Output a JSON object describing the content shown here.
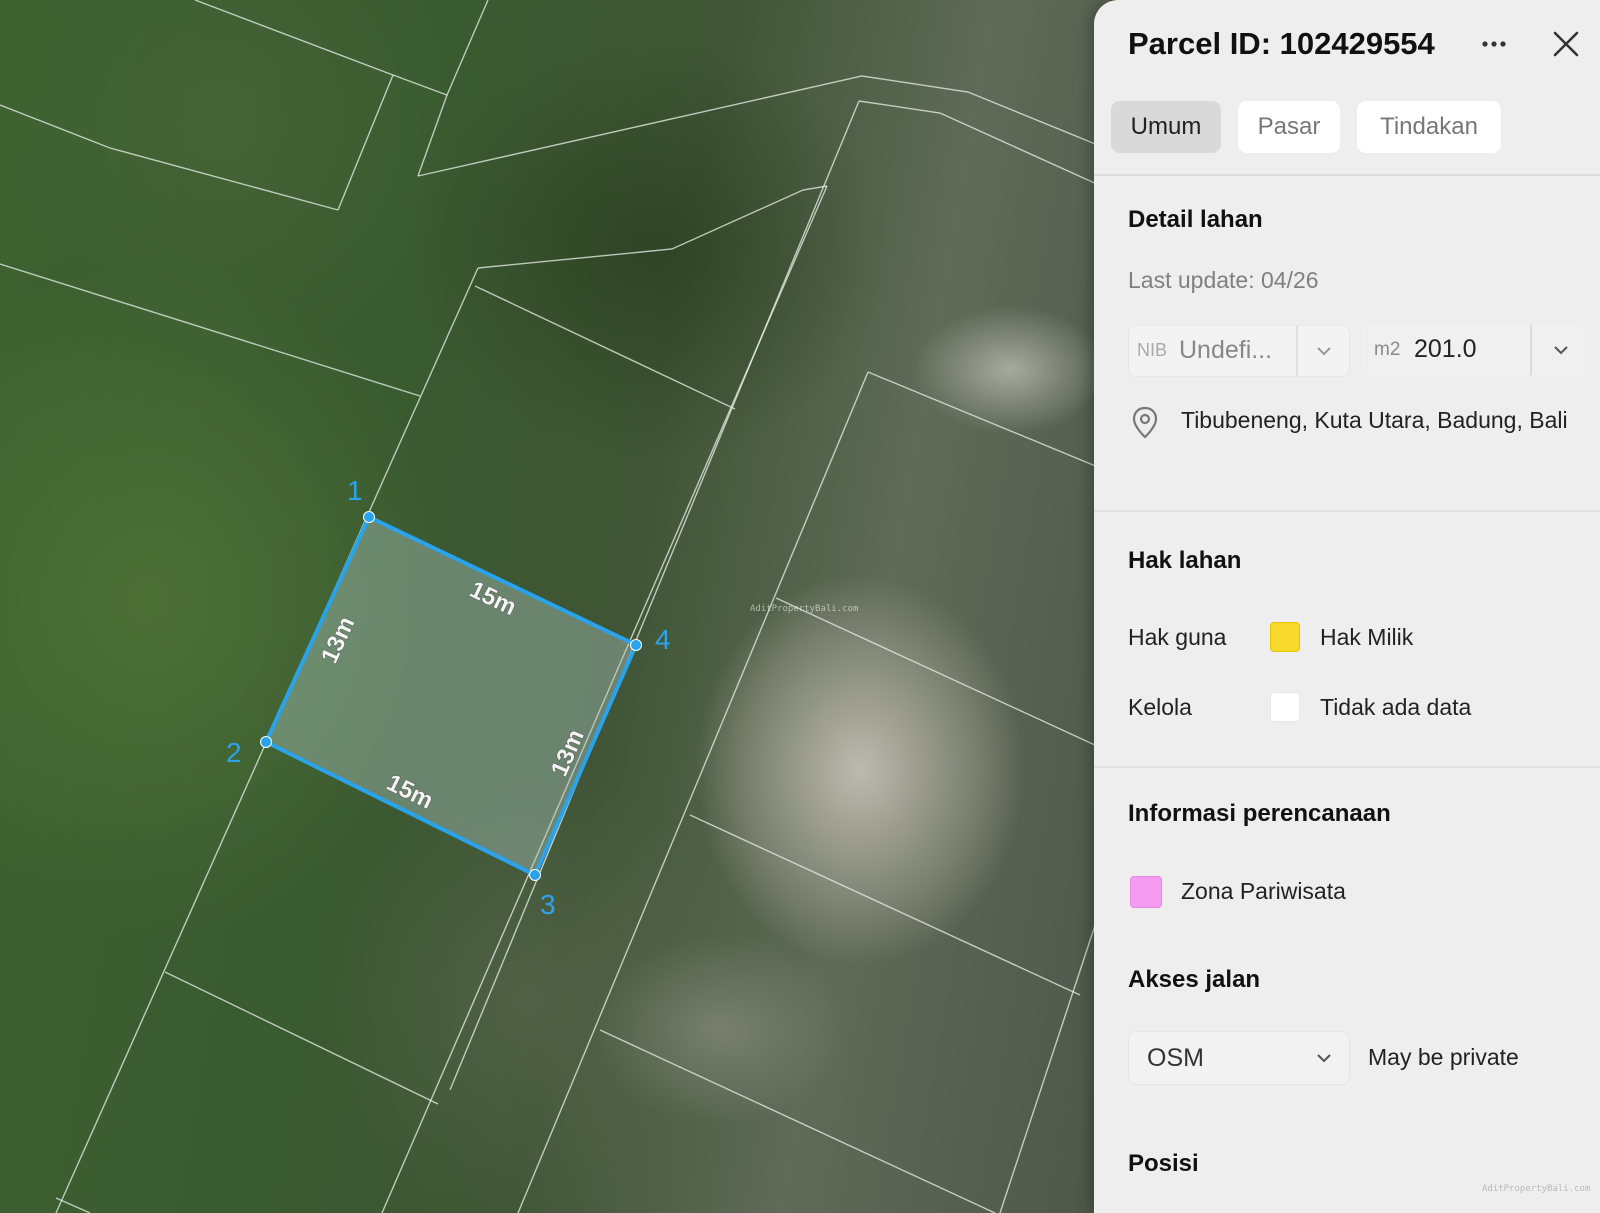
{
  "map": {
    "vertex_labels": [
      "1",
      "2",
      "3",
      "4"
    ],
    "edge_labels": {
      "top": "15m",
      "left": "13m",
      "bottom": "15m",
      "right": "13m"
    },
    "watermark": "AditPropertyBali.com",
    "corner_watermark": "AditPropertyBali.com",
    "selection_color": "#29a3ec"
  },
  "panel": {
    "title": "Parcel ID: 102429554",
    "more_icon": "more-horizontal-icon",
    "close_icon": "close-icon",
    "tabs": [
      {
        "label": "Umum",
        "active": true
      },
      {
        "label": "Pasar",
        "active": false
      },
      {
        "label": "Tindakan",
        "active": false
      }
    ],
    "land_detail": {
      "heading": "Detail lahan",
      "last_update": "Last update: 04/26",
      "nib_prefix": "NIB",
      "nib_value": "Undefi...",
      "area_unit": "m2",
      "area_value": "201.0",
      "location_icon": "map-pin-icon",
      "address": "Tibubeneng, Kuta Utara, Badung, Bali"
    },
    "land_rights": {
      "heading": "Hak lahan",
      "rows": [
        {
          "label": "Hak guna",
          "value": "Hak Milik",
          "color": "#f7d92b"
        },
        {
          "label": "Kelola",
          "value": "Tidak ada data",
          "color": "#ffffff"
        }
      ]
    },
    "planning": {
      "heading": "Informasi perencanaan",
      "zone": "Zona Pariwisata",
      "zone_color": "#f59cf2"
    },
    "road_access": {
      "heading": "Akses jalan",
      "source": "OSM",
      "status": "May be private"
    },
    "position": {
      "heading": "Posisi"
    }
  }
}
